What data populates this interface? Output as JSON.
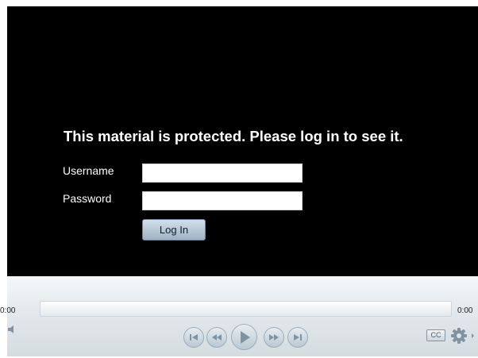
{
  "login": {
    "title": "This material is protected. Please log in to see it.",
    "username_label": "Username",
    "password_label": "Password",
    "username_value": "",
    "password_value": "",
    "login_button_label": "Log In"
  },
  "player": {
    "current_time": "0:00",
    "total_time": "0:00",
    "progress": 0,
    "cc_label": "CC",
    "icons": [
      "volume-icon",
      "previous-icon",
      "rewind-icon",
      "play-icon",
      "fast-forward-icon",
      "next-icon",
      "settings-gear-icon"
    ]
  },
  "colors": {
    "screen_background": "#000000",
    "login_button": "#b3c5d2",
    "control_icon": "#7f94a3"
  }
}
